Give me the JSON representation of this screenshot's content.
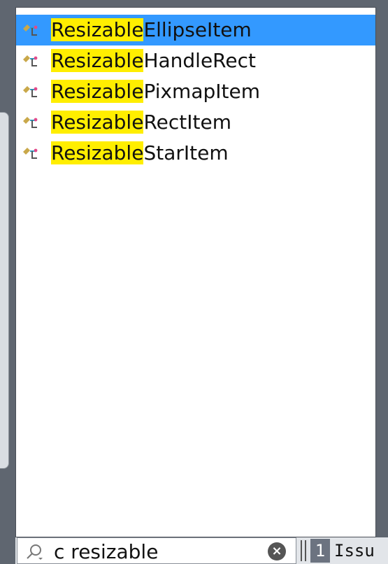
{
  "results": [
    {
      "match": "Resizable",
      "rest": "EllipseItem",
      "selected": true
    },
    {
      "match": "Resizable",
      "rest": "HandleRect",
      "selected": false
    },
    {
      "match": "Resizable",
      "rest": "PixmapItem",
      "selected": false
    },
    {
      "match": "Resizable",
      "rest": "RectItem",
      "selected": false
    },
    {
      "match": "Resizable",
      "rest": "StarItem",
      "selected": false
    }
  ],
  "search": {
    "value": "c resizable"
  },
  "bottom_tab": {
    "number": "1",
    "label": "Issu"
  },
  "colors": {
    "selection": "#3399ff",
    "highlight": "#ffee00",
    "background": "#5f6670"
  },
  "icons": {
    "result": "class-icon",
    "search": "search-icon",
    "clear": "clear-icon"
  }
}
